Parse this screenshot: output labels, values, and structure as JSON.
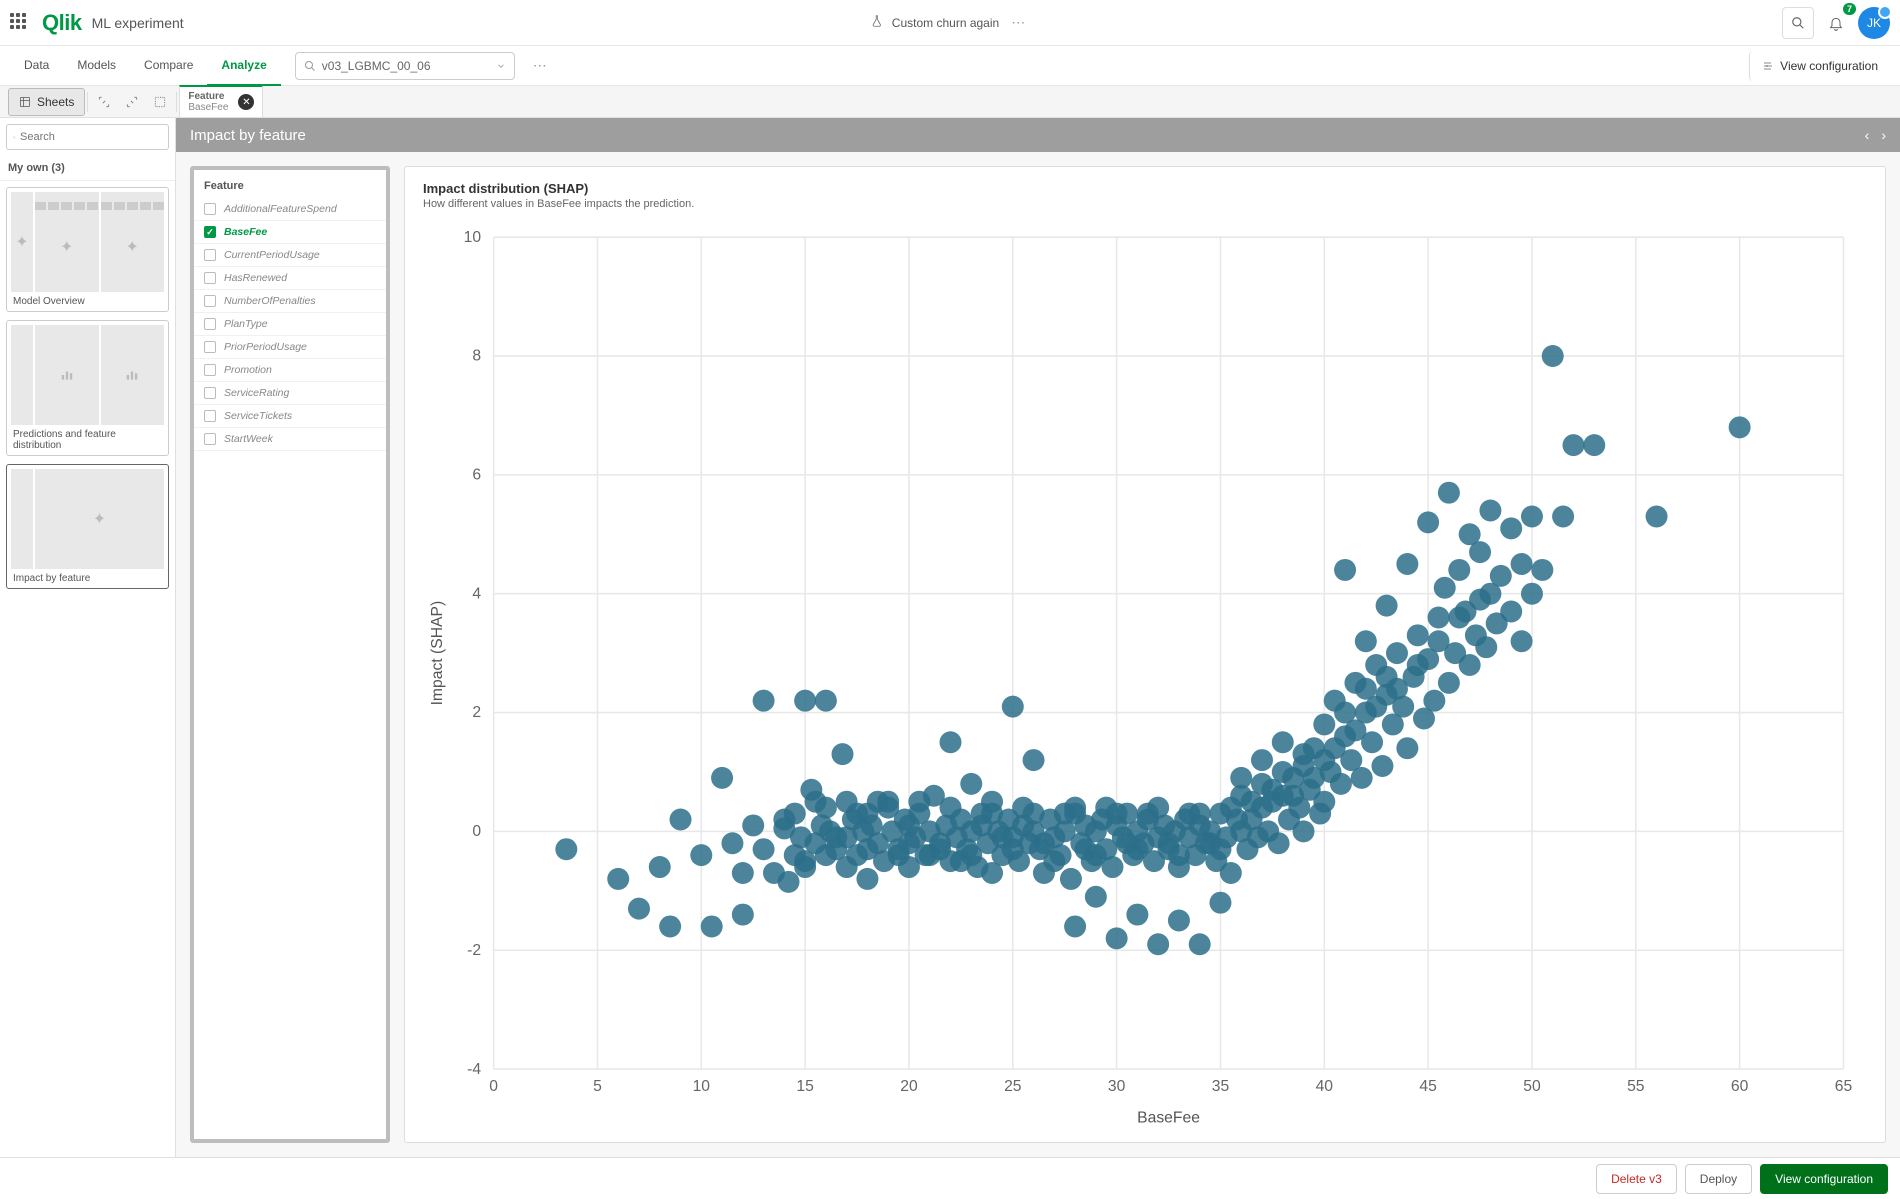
{
  "header": {
    "logo_text": "Qlik",
    "page_title": "ML experiment",
    "experiment_name": "Custom churn again",
    "notif_count": "7",
    "avatar_initials": "JK"
  },
  "nav": {
    "tabs": [
      {
        "label": "Data"
      },
      {
        "label": "Models"
      },
      {
        "label": "Compare"
      },
      {
        "label": "Analyze"
      }
    ],
    "active_tab": "Analyze",
    "model_selected": "v03_LGBMC_00_06",
    "view_config_label": "View configuration"
  },
  "toolbar": {
    "sheets_label": "Sheets",
    "filter_label": "Feature",
    "filter_value": "BaseFee"
  },
  "left": {
    "search_placeholder": "Search",
    "my_own_label": "My own (3)",
    "sheets": [
      {
        "label": "Model Overview"
      },
      {
        "label": "Predictions and feature distribution"
      },
      {
        "label": "Impact by feature"
      }
    ],
    "active_sheet": "Impact by feature"
  },
  "content": {
    "impact_title": "Impact by feature",
    "feature_panel_title": "Feature",
    "features": [
      {
        "label": "AdditionalFeatureSpend",
        "selected": false
      },
      {
        "label": "BaseFee",
        "selected": true
      },
      {
        "label": "CurrentPeriodUsage",
        "selected": false
      },
      {
        "label": "HasRenewed",
        "selected": false
      },
      {
        "label": "NumberOfPenalties",
        "selected": false
      },
      {
        "label": "PlanType",
        "selected": false
      },
      {
        "label": "PriorPeriodUsage",
        "selected": false
      },
      {
        "label": "Promotion",
        "selected": false
      },
      {
        "label": "ServiceRating",
        "selected": false
      },
      {
        "label": "ServiceTickets",
        "selected": false
      },
      {
        "label": "StartWeek",
        "selected": false
      }
    ],
    "chart_title": "Impact distribution (SHAP)",
    "chart_sub": "How different values in BaseFee impacts the prediction."
  },
  "footer": {
    "delete_label": "Delete v3",
    "deploy_label": "Deploy",
    "view_config_label": "View configuration"
  },
  "chart_data": {
    "type": "scatter",
    "title": "Impact distribution (SHAP)",
    "xlabel": "BaseFee",
    "ylabel": "Impact (SHAP)",
    "xlim": [
      0,
      65
    ],
    "ylim": [
      -4,
      10
    ],
    "xticks": [
      0,
      5,
      10,
      15,
      20,
      25,
      30,
      35,
      40,
      45,
      50,
      55,
      60,
      65
    ],
    "yticks": [
      -4,
      -2,
      0,
      2,
      4,
      6,
      8,
      10
    ],
    "n_points_approx": 400,
    "approx_trend": "Roughly flat near 0 for BaseFee 5–35, rising to ~4–8 for BaseFee 40–60",
    "sample_points": [
      [
        3.5,
        -0.3
      ],
      [
        6,
        -0.8
      ],
      [
        7,
        -1.3
      ],
      [
        8,
        -0.6
      ],
      [
        8.5,
        -1.6
      ],
      [
        9,
        0.2
      ],
      [
        10,
        -0.4
      ],
      [
        10.5,
        -1.6
      ],
      [
        11,
        0.9
      ],
      [
        11.5,
        -0.2
      ],
      [
        12,
        -0.7
      ],
      [
        12,
        -1.4
      ],
      [
        12.5,
        0.1
      ],
      [
        13,
        -0.3
      ],
      [
        13,
        2.2
      ],
      [
        13.5,
        -0.7
      ],
      [
        14,
        0.05
      ],
      [
        14.2,
        -0.85
      ],
      [
        14.5,
        0.3
      ],
      [
        14.8,
        -0.1
      ],
      [
        15,
        2.2
      ],
      [
        15,
        -0.5
      ],
      [
        15.3,
        0.7
      ],
      [
        15.5,
        -0.2
      ],
      [
        15.8,
        0.1
      ],
      [
        16,
        -0.4
      ],
      [
        16,
        2.2
      ],
      [
        16.2,
        0.0
      ],
      [
        16.5,
        -0.3
      ],
      [
        16.8,
        1.3
      ],
      [
        17,
        -0.1
      ],
      [
        17,
        -0.6
      ],
      [
        17.3,
        0.2
      ],
      [
        17.5,
        -0.4
      ],
      [
        17.8,
        0.0
      ],
      [
        18,
        0.3
      ],
      [
        18,
        -0.8
      ],
      [
        18.2,
        0.1
      ],
      [
        18.5,
        -0.2
      ],
      [
        18.8,
        -0.5
      ],
      [
        19,
        0.4
      ],
      [
        19.2,
        0.0
      ],
      [
        19.5,
        -0.3
      ],
      [
        19.8,
        0.2
      ],
      [
        20,
        -0.6
      ],
      [
        20,
        0.1
      ],
      [
        20.3,
        -0.1
      ],
      [
        20.5,
        0.3
      ],
      [
        20.8,
        -0.4
      ],
      [
        21,
        0.0
      ],
      [
        21.2,
        0.6
      ],
      [
        21.5,
        -0.2
      ],
      [
        21.8,
        0.1
      ],
      [
        22,
        -0.5
      ],
      [
        22,
        1.5
      ],
      [
        22.3,
        -0.1
      ],
      [
        22.5,
        0.2
      ],
      [
        22.8,
        -0.3
      ],
      [
        23,
        0.0
      ],
      [
        23,
        0.8
      ],
      [
        23.3,
        -0.6
      ],
      [
        23.5,
        0.1
      ],
      [
        23.8,
        -0.2
      ],
      [
        24,
        0.3
      ],
      [
        24,
        -0.7
      ],
      [
        24.3,
        0.0
      ],
      [
        24.5,
        -0.4
      ],
      [
        24.8,
        0.2
      ],
      [
        25,
        -0.1
      ],
      [
        25,
        2.1
      ],
      [
        25.3,
        -0.5
      ],
      [
        25.5,
        0.1
      ],
      [
        25.8,
        -0.2
      ],
      [
        26,
        0.0
      ],
      [
        26,
        1.2
      ],
      [
        26.3,
        -0.3
      ],
      [
        26.5,
        -0.7
      ],
      [
        26.8,
        0.2
      ],
      [
        27,
        -0.1
      ],
      [
        27.3,
        -0.4
      ],
      [
        27.5,
        0.0
      ],
      [
        27.8,
        -0.8
      ],
      [
        28,
        0.3
      ],
      [
        28,
        -1.6
      ],
      [
        28.3,
        -0.2
      ],
      [
        28.5,
        0.1
      ],
      [
        28.8,
        -0.5
      ],
      [
        29,
        0.0
      ],
      [
        29,
        -1.1
      ],
      [
        29.3,
        0.2
      ],
      [
        29.5,
        -0.3
      ],
      [
        29.8,
        -0.6
      ],
      [
        30,
        0.1
      ],
      [
        30,
        -1.8
      ],
      [
        30.3,
        -0.1
      ],
      [
        30.5,
        0.3
      ],
      [
        30.8,
        -0.4
      ],
      [
        31,
        0.0
      ],
      [
        31,
        -1.4
      ],
      [
        31.3,
        -0.2
      ],
      [
        31.5,
        0.2
      ],
      [
        31.8,
        -0.5
      ],
      [
        32,
        -0.1
      ],
      [
        32,
        -1.9
      ],
      [
        32.3,
        0.1
      ],
      [
        32.5,
        -0.3
      ],
      [
        32.8,
        0.0
      ],
      [
        33,
        -0.6
      ],
      [
        33,
        -1.5
      ],
      [
        33.3,
        0.2
      ],
      [
        33.5,
        -0.1
      ],
      [
        33.8,
        -0.4
      ],
      [
        34,
        0.1
      ],
      [
        34,
        -1.9
      ],
      [
        34.3,
        -0.2
      ],
      [
        34.5,
        0.0
      ],
      [
        34.8,
        -0.5
      ],
      [
        35,
        0.3
      ],
      [
        35,
        -1.2
      ],
      [
        35.3,
        -0.1
      ],
      [
        35.5,
        -0.7
      ],
      [
        35.8,
        0.2
      ],
      [
        36,
        0.0
      ],
      [
        36,
        0.9
      ],
      [
        36.3,
        -0.3
      ],
      [
        36.5,
        0.5
      ],
      [
        36.8,
        -0.1
      ],
      [
        37,
        0.4
      ],
      [
        37,
        1.2
      ],
      [
        37.3,
        0.0
      ],
      [
        37.5,
        0.7
      ],
      [
        37.8,
        -0.2
      ],
      [
        38,
        0.6
      ],
      [
        38,
        1.5
      ],
      [
        38.3,
        0.2
      ],
      [
        38.5,
        0.9
      ],
      [
        38.8,
        0.4
      ],
      [
        39,
        1.1
      ],
      [
        39,
        0.0
      ],
      [
        39.3,
        0.7
      ],
      [
        39.5,
        1.4
      ],
      [
        39.8,
        0.3
      ],
      [
        40,
        1.8
      ],
      [
        40,
        0.5
      ],
      [
        40.3,
        1.0
      ],
      [
        40.5,
        2.2
      ],
      [
        40.8,
        0.8
      ],
      [
        41,
        1.6
      ],
      [
        41,
        4.4
      ],
      [
        41.3,
        1.2
      ],
      [
        41.5,
        2.5
      ],
      [
        41.8,
        0.9
      ],
      [
        42,
        2.0
      ],
      [
        42,
        3.2
      ],
      [
        42.3,
        1.5
      ],
      [
        42.5,
        2.8
      ],
      [
        42.8,
        1.1
      ],
      [
        43,
        2.3
      ],
      [
        43,
        3.8
      ],
      [
        43.3,
        1.8
      ],
      [
        43.5,
        3.0
      ],
      [
        43.8,
        2.1
      ],
      [
        44,
        1.4
      ],
      [
        44,
        4.5
      ],
      [
        44.3,
        2.6
      ],
      [
        44.5,
        3.3
      ],
      [
        44.8,
        1.9
      ],
      [
        45,
        2.9
      ],
      [
        45,
        5.2
      ],
      [
        45.3,
        2.2
      ],
      [
        45.5,
        3.6
      ],
      [
        45.8,
        4.1
      ],
      [
        46,
        2.5
      ],
      [
        46,
        5.7
      ],
      [
        46.3,
        3.0
      ],
      [
        46.5,
        4.4
      ],
      [
        46.8,
        3.7
      ],
      [
        47,
        2.8
      ],
      [
        47,
        5.0
      ],
      [
        47.3,
        3.3
      ],
      [
        47.5,
        4.7
      ],
      [
        47.8,
        3.1
      ],
      [
        48,
        4.0
      ],
      [
        48,
        5.4
      ],
      [
        48.3,
        3.5
      ],
      [
        48.5,
        4.3
      ],
      [
        49,
        3.7
      ],
      [
        49,
        5.1
      ],
      [
        49.5,
        4.5
      ],
      [
        49.5,
        3.2
      ],
      [
        50,
        4.0
      ],
      [
        50,
        5.3
      ],
      [
        50.5,
        4.4
      ],
      [
        51,
        8.0
      ],
      [
        51.5,
        5.3
      ],
      [
        52,
        6.5
      ],
      [
        53,
        6.5
      ],
      [
        56,
        5.3
      ],
      [
        60,
        6.8
      ]
    ]
  }
}
